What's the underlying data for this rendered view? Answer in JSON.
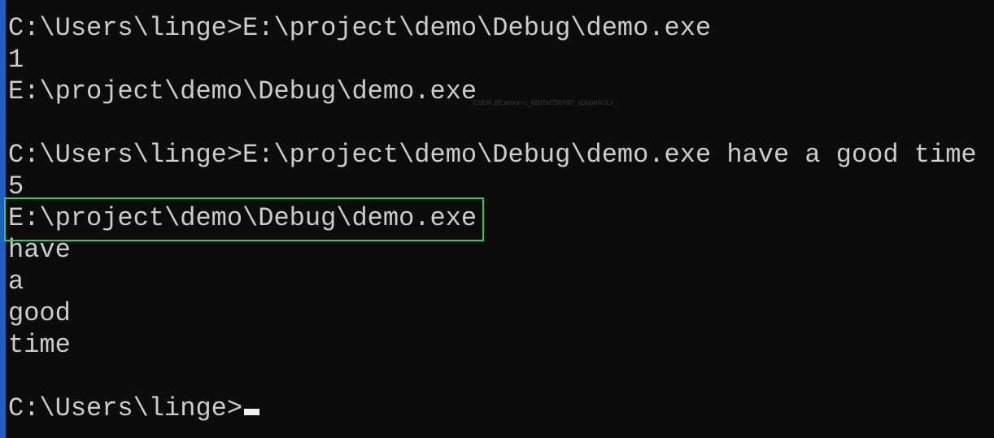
{
  "terminal": {
    "lines": [
      "C:\\Users\\linge>E:\\project\\demo\\Debug\\demo.exe",
      "1",
      "E:\\project\\demo\\Debug\\demo.exe",
      "",
      "C:\\Users\\linge>E:\\project\\demo\\Debug\\demo.exe have a good time",
      "5",
      "E:\\project\\demo\\Debug\\demo.exe",
      "have",
      "a",
      "good",
      "time",
      "",
      "C:\\Users\\linge>"
    ],
    "highlight_color": "#2ecc5a",
    "accent_color": "#1f5fbf"
  },
  "watermark": "CSDN @Lanson-u_62b7af75676f7_vDuprhh7Lx"
}
